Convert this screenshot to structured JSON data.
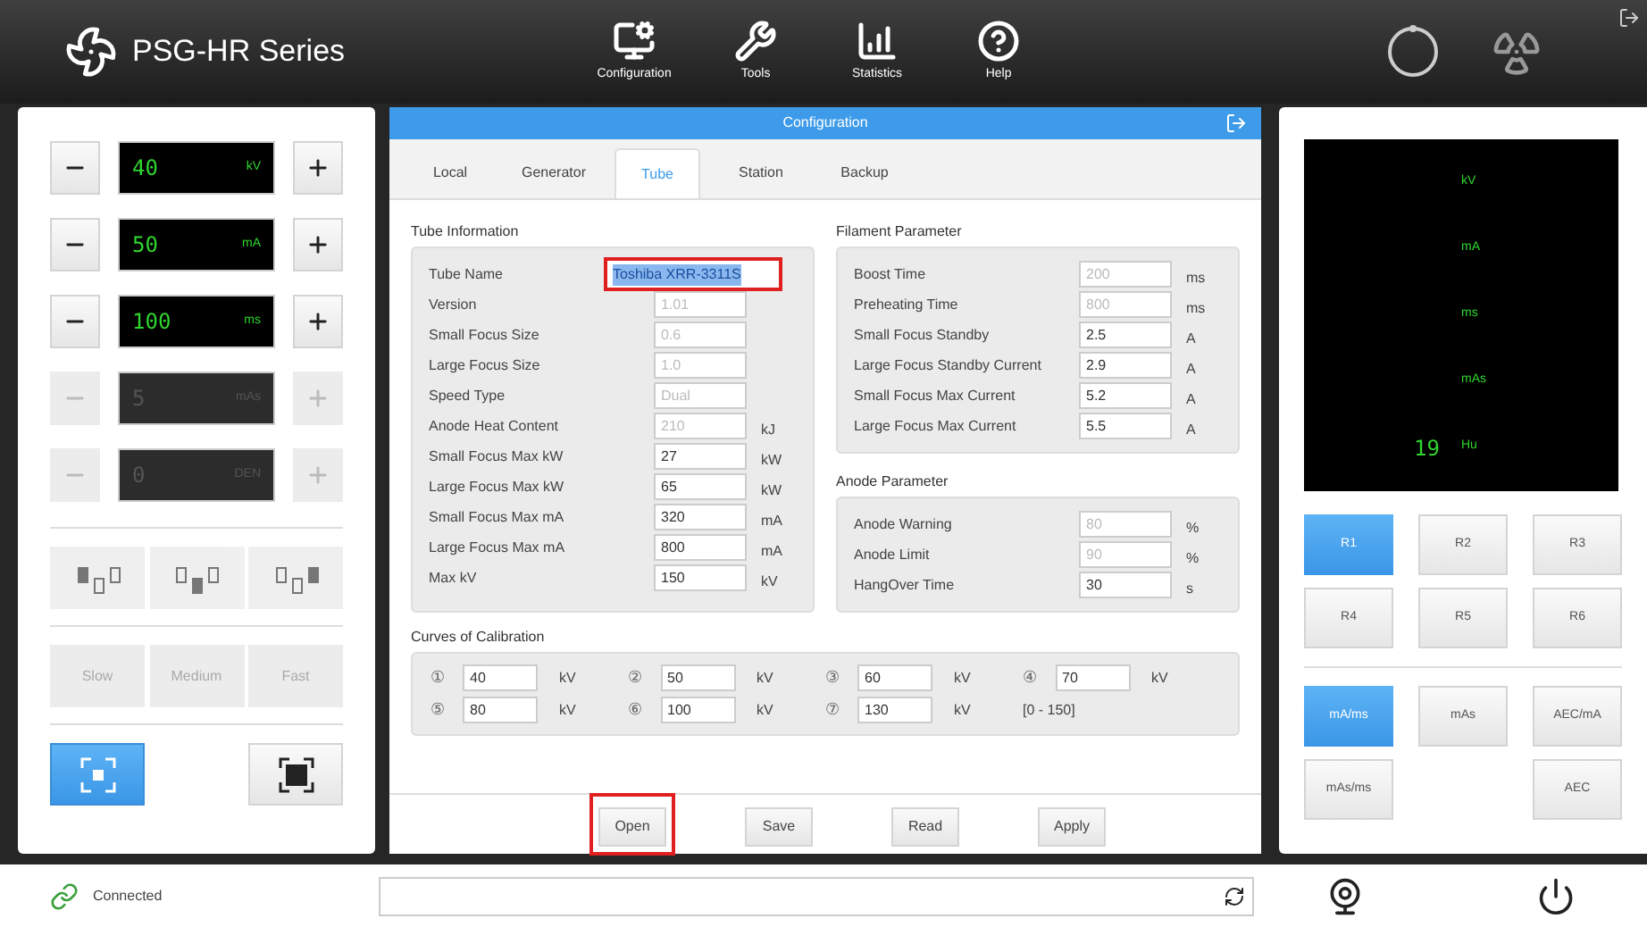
{
  "header": {
    "title": "PSG-HR Series",
    "nav": [
      {
        "kind": "config",
        "label": "Configuration"
      },
      {
        "kind": "tools",
        "label": "Tools"
      },
      {
        "kind": "stats",
        "label": "Statistics"
      },
      {
        "kind": "help",
        "label": "Help"
      }
    ]
  },
  "left_panel": {
    "steppers": [
      {
        "value": "40",
        "unit": "kV",
        "disabled": false
      },
      {
        "value": "50",
        "unit": "mA",
        "disabled": false
      },
      {
        "value": "100",
        "unit": "ms",
        "disabled": false
      },
      {
        "value": "5",
        "unit": "mAs",
        "disabled": true
      },
      {
        "value": "0",
        "unit": "DEN",
        "disabled": true
      }
    ],
    "focal_positions": [
      {
        "kind": "left",
        "disabled": true
      },
      {
        "kind": "middle",
        "disabled": true
      },
      {
        "kind": "right",
        "disabled": true
      }
    ],
    "speeds": [
      {
        "label": "Slow",
        "disabled": true
      },
      {
        "label": "Medium",
        "disabled": true
      },
      {
        "label": "Fast",
        "disabled": true
      }
    ],
    "focus_modes": [
      {
        "kind": "small",
        "selected": true
      },
      {
        "kind": "large",
        "selected": false
      }
    ]
  },
  "dialog": {
    "title": "Configuration",
    "tabs": [
      {
        "label": "Local",
        "selected": false
      },
      {
        "label": "Generator",
        "selected": false
      },
      {
        "label": "Tube",
        "selected": true
      },
      {
        "label": "Station",
        "selected": false
      },
      {
        "label": "Backup",
        "selected": false
      }
    ],
    "tube_information": {
      "title": "Tube Information",
      "rows": [
        {
          "label": "Tube Name",
          "value": "Toshiba XRR-3311S",
          "disabled": false,
          "highlighted": true
        },
        {
          "label": "Version",
          "value": "1.01",
          "disabled": true,
          "highlighted": false
        },
        {
          "label": "Small Focus Size",
          "value": "0.6",
          "disabled": true,
          "highlighted": false
        },
        {
          "label": "Large Focus Size",
          "value": "1.0",
          "disabled": true,
          "highlighted": false
        },
        {
          "label": "Speed Type",
          "value": "Dual",
          "disabled": true,
          "highlighted": false
        },
        {
          "label": "Anode Heat Content",
          "value": "210",
          "unit": "kJ",
          "disabled": true,
          "highlighted": false
        },
        {
          "label": "Small Focus Max kW",
          "value": "27",
          "unit": "kW",
          "disabled": false,
          "highlighted": false
        },
        {
          "label": "Large Focus Max kW",
          "value": "65",
          "unit": "kW",
          "disabled": false,
          "highlighted": false
        },
        {
          "label": "Small Focus Max mA",
          "value": "320",
          "unit": "mA",
          "disabled": false,
          "highlighted": false
        },
        {
          "label": "Large Focus Max mA",
          "value": "800",
          "unit": "mA",
          "disabled": false,
          "highlighted": false
        },
        {
          "label": "Max kV",
          "value": "150",
          "unit": "kV",
          "disabled": false,
          "highlighted": false
        }
      ]
    },
    "filament_parameter": {
      "title": "Filament Parameter",
      "rows": [
        {
          "label": "Boost Time",
          "value": "200",
          "unit": "ms",
          "disabled": true,
          "highlighted": false
        },
        {
          "label": "Preheating Time",
          "value": "800",
          "unit": "ms",
          "disabled": true,
          "highlighted": false
        },
        {
          "label": "Small Focus Standby",
          "value": "2.5",
          "unit": "A",
          "disabled": false,
          "highlighted": false
        },
        {
          "label": "Large Focus Standby Current",
          "value": "2.9",
          "unit": "A",
          "disabled": false,
          "highlighted": false
        },
        {
          "label": "Small Focus Max Current",
          "value": "5.2",
          "unit": "A",
          "disabled": false,
          "highlighted": false
        },
        {
          "label": "Large Focus Max Current",
          "value": "5.5",
          "unit": "A",
          "disabled": false,
          "highlighted": false
        }
      ]
    },
    "anode_parameter": {
      "title": "Anode Parameter",
      "rows": [
        {
          "label": "Anode Warning",
          "value": "80",
          "unit": "%",
          "disabled": true,
          "highlighted": false
        },
        {
          "label": "Anode Limit",
          "value": "90",
          "unit": "%",
          "disabled": true,
          "highlighted": false
        },
        {
          "label": "HangOver Time",
          "value": "30",
          "unit": "s",
          "disabled": false,
          "highlighted": false
        }
      ]
    },
    "curves_of_calibration": {
      "title": "Curves of Calibration",
      "points": [
        {
          "mark": "①",
          "value": "40",
          "unit": "kV"
        },
        {
          "mark": "②",
          "value": "50",
          "unit": "kV"
        },
        {
          "mark": "③",
          "value": "60",
          "unit": "kV"
        },
        {
          "mark": "④",
          "value": "70",
          "unit": "kV"
        },
        {
          "mark": "⑤",
          "value": "80",
          "unit": "kV"
        },
        {
          "mark": "⑥",
          "value": "100",
          "unit": "kV"
        },
        {
          "mark": "⑦",
          "value": "130",
          "unit": "kV"
        }
      ],
      "range": "[0 - 150]"
    },
    "buttons": [
      {
        "label": "Open",
        "highlighted": true
      },
      {
        "label": "Save",
        "highlighted": false
      },
      {
        "label": "Read",
        "highlighted": false
      },
      {
        "label": "Apply",
        "highlighted": false
      }
    ]
  },
  "right_panel": {
    "readings": [
      {
        "unit": "kV"
      },
      {
        "unit": "mA"
      },
      {
        "unit": "ms"
      },
      {
        "unit": "mAs"
      },
      {
        "value": "19",
        "unit": "Hu"
      }
    ],
    "programs": [
      {
        "label": "R1",
        "selected": true
      },
      {
        "label": "R2",
        "selected": false
      },
      {
        "label": "R3",
        "selected": false
      },
      {
        "label": "R4",
        "selected": false
      },
      {
        "label": "R5",
        "selected": false
      },
      {
        "label": "R6",
        "selected": false
      }
    ],
    "modes": [
      {
        "label": "mA/ms",
        "selected": true
      },
      {
        "label": "mAs",
        "selected": false
      },
      {
        "label": "AEC/mA",
        "selected": false
      },
      {
        "label": "mAs/ms",
        "selected": false
      },
      {
        "kind": "gap"
      },
      {
        "label": "AEC",
        "selected": false
      }
    ]
  },
  "status_bar": {
    "connection": "Connected"
  }
}
